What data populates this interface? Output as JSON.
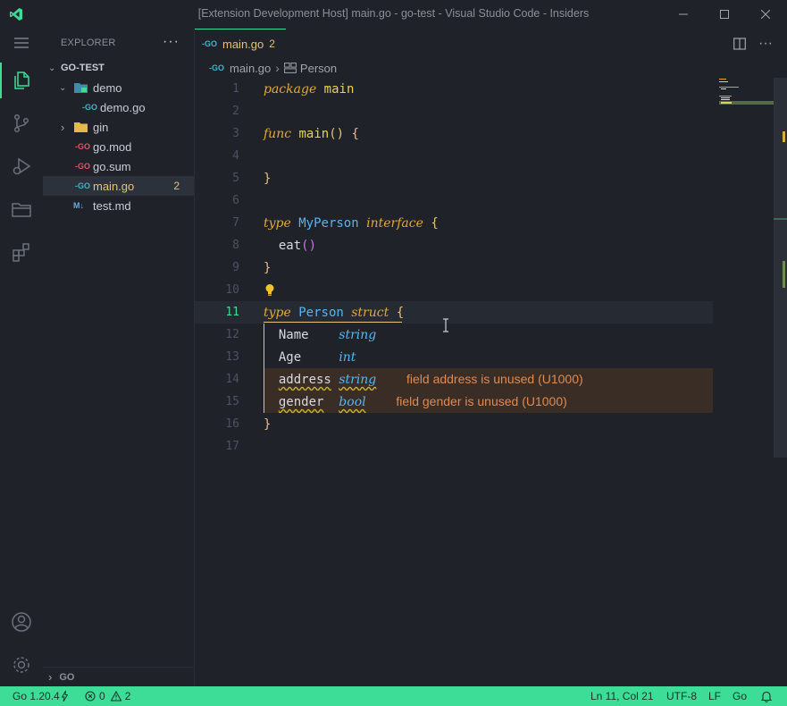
{
  "window": {
    "title": "[Extension Development Host] main.go - go-test - Visual Studio Code - Insiders",
    "controls": [
      "minimize-icon",
      "maximize-icon",
      "close-icon"
    ]
  },
  "activity_bar": {
    "items": [
      "menu-icon",
      "explorer-icon",
      "source-control-icon",
      "run-debug-icon",
      "folder-icon",
      "extensions-icon"
    ],
    "bottom": [
      "account-icon",
      "settings-gear-icon"
    ]
  },
  "sidebar": {
    "header": "EXPLORER",
    "more": "···",
    "root": "GO-TEST",
    "items": [
      {
        "label": "demo",
        "type": "folder",
        "expanded": true
      },
      {
        "label": "demo.go",
        "type": "go"
      },
      {
        "label": "gin",
        "type": "folder",
        "expanded": false
      },
      {
        "label": "go.mod",
        "type": "go-mod"
      },
      {
        "label": "go.sum",
        "type": "go-mod"
      },
      {
        "label": "main.go",
        "type": "go",
        "badge": "2"
      },
      {
        "label": "test.md",
        "type": "markdown"
      }
    ],
    "go_section": "GO"
  },
  "editor": {
    "tab": {
      "label": "main.go",
      "count": "2"
    },
    "breadcrumb": {
      "file": "main.go",
      "symbol": "Person"
    },
    "lines": [
      "1",
      "2",
      "3",
      "4",
      "5",
      "6",
      "7",
      "8",
      "9",
      "10",
      "11",
      "12",
      "13",
      "14",
      "15",
      "16",
      "17"
    ],
    "code": {
      "l1_kw": "package",
      "l1_name": "main",
      "l3_kw": "func",
      "l3_name": "main",
      "l3_rest": "() {",
      "l5": "}",
      "l7_kw": "type",
      "l7_name": "MyPerson",
      "l7_kw2": "interface",
      "l7_br": "{",
      "l8_name": "eat",
      "l8_rest": "()",
      "l9": "}",
      "l11_kw": "type",
      "l11_name": "Person",
      "l11_kw2": "struct",
      "l11_br": "{",
      "l12_field": "Name",
      "l12_type": "string",
      "l13_field": "Age",
      "l13_type": "int",
      "l14_field": "address",
      "l14_type": "string",
      "l15_field": "gender",
      "l15_type": "bool",
      "l16": "}"
    },
    "diagnostics": {
      "l14": "field address is unused (U1000)",
      "l15": "field gender is unused (U1000)"
    }
  },
  "statusbar": {
    "go_version": "Go 1.20.4",
    "errors": "0",
    "warnings": "2",
    "position": "Ln 11, Col 21",
    "encoding": "UTF-8",
    "eol": "LF",
    "language": "Go"
  },
  "colors": {
    "accent": "#3ddc97",
    "background": "#1f2229",
    "warning": "#e08a4f"
  }
}
